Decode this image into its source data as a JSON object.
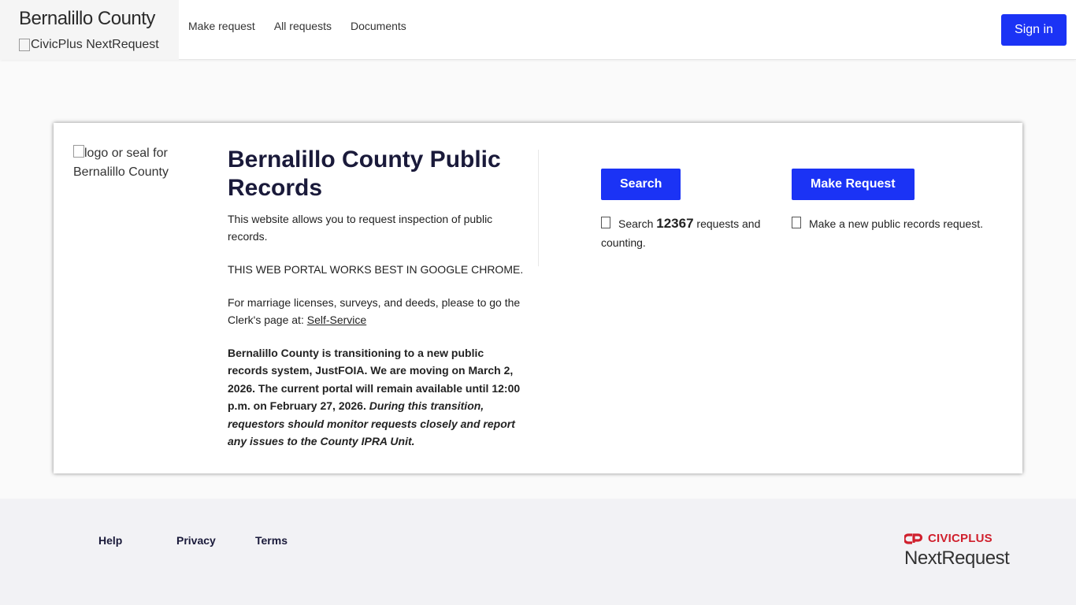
{
  "header": {
    "brand_title": "Bernalillo County",
    "brand_logo_alt": "CivicPlus NextRequest",
    "nav": [
      "Make request",
      "All requests",
      "Documents"
    ],
    "sign_in": "Sign in"
  },
  "intro": {
    "logo_alt": "logo or seal for Bernalillo County",
    "title": "Bernalillo County Public Records",
    "p1": "This website allows you to request inspection of public records.",
    "p2": "THIS WEB PORTAL WORKS BEST IN GOOGLE CHROME.",
    "p3_prefix": "For marriage licenses, surveys, and deeds, please to go the Clerk's page at: ",
    "p3_link": "Self-Service",
    "notice_bold": "Bernalillo County is transitioning to a new public records system, JustFOIA. We are moving on March 2, 2026. The current portal will remain available until 12:00 p.m. on February 27, 2026. ",
    "notice_italic": "During this transition, requestors should monitor requests closely and report any issues to the County IPRA Unit."
  },
  "actions": {
    "search": {
      "label": "Search",
      "desc_prefix": "Search ",
      "count": "12367",
      "desc_suffix": " requests and counting."
    },
    "make_request": {
      "label": "Make Request",
      "desc": "Make a new public records request."
    }
  },
  "footer": {
    "links": [
      "Help",
      "Privacy",
      "Terms"
    ],
    "logo_brand": "CIVICPLUS",
    "logo_product": "NextRequest"
  },
  "colors": {
    "primary": "#1b33f5",
    "brand_red": "#d0202d"
  }
}
